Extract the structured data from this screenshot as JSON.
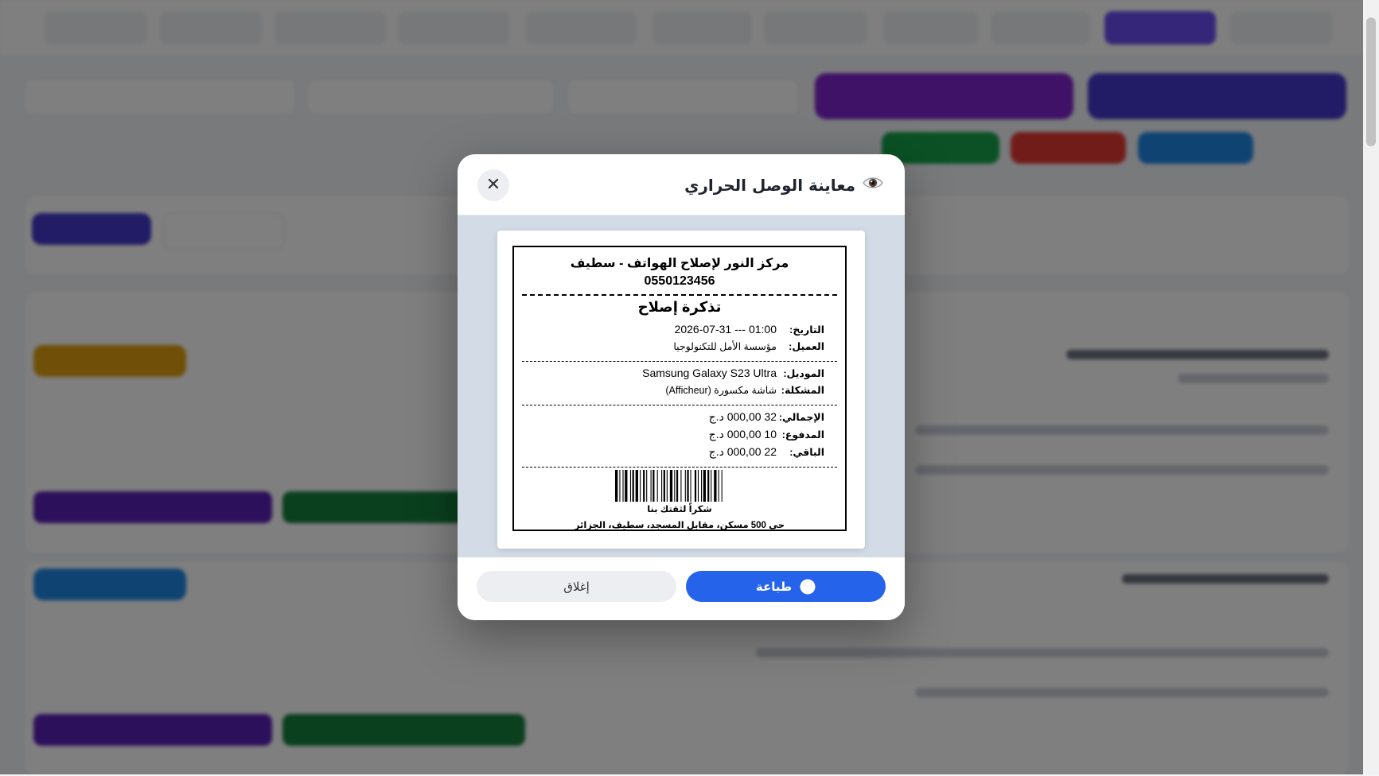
{
  "modal": {
    "title": "معاينة الوصل الحراري",
    "close_symbol": "✕",
    "print_label": "طباعة",
    "close_label": "إغلاق"
  },
  "receipt": {
    "shop_name": "مركز النور لإصلاح الهواتف - سطيف",
    "shop_phone": "0550123456",
    "ticket_title": "تذكرة إصلاح",
    "date_label": "التاريخ:",
    "date_value": "2026-07-31 --- 01:00",
    "client_label": "العميل:",
    "client_value": "مؤسسة الأمل للتكنولوجيا",
    "model_label": "الموديل:",
    "model_value": "Samsung Galaxy S23 Ultra",
    "problem_label": "المشكلة:",
    "problem_value": "شاشة مكسورة (Afficheur)",
    "total_label": "الإجمالي:",
    "total_value": "32 000,00 د.ج",
    "paid_label": "المدفوع:",
    "paid_value": "10 000,00 د.ج",
    "rest_label": "الباقي:",
    "rest_value": "22 000,00 د.ج",
    "thanks": "شكراً لثقتك بنا",
    "address": "حي 500 مسكن، مقابل المسجد، سطيف، الجزائر"
  },
  "icons": {
    "title_icon": "eye-icon",
    "print_icon": "printer-icon",
    "barcode": "barcode-graphic"
  },
  "colors": {
    "primary": "#2563eb",
    "accent_purple": "#6d4df2",
    "overlay": "rgba(0,0,0,0.5)"
  }
}
